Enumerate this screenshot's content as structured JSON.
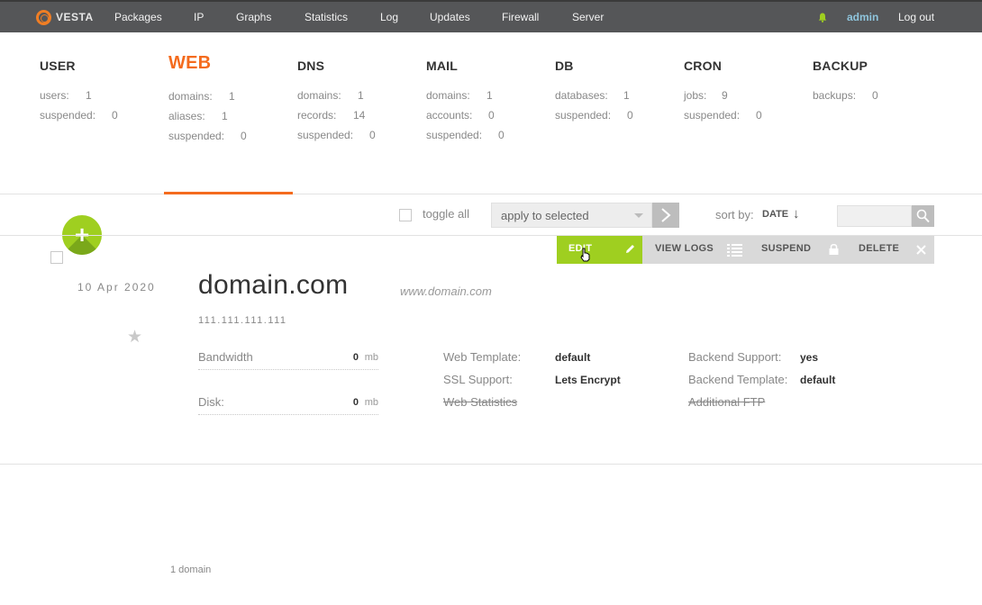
{
  "topbar": {
    "logo_text": "VESTA",
    "nav": [
      "Packages",
      "IP",
      "Graphs",
      "Statistics",
      "Log",
      "Updates",
      "Firewall",
      "Server"
    ],
    "user": "admin",
    "logout": "Log out"
  },
  "stats": [
    {
      "title": "USER",
      "rows": [
        {
          "label": "users:",
          "value": "1"
        },
        {
          "label": "suspended:",
          "value": "0"
        }
      ]
    },
    {
      "title": "WEB",
      "active": true,
      "rows": [
        {
          "label": "domains:",
          "value": "1"
        },
        {
          "label": "aliases:",
          "value": "1"
        },
        {
          "label": "suspended:",
          "value": "0"
        }
      ]
    },
    {
      "title": "DNS",
      "rows": [
        {
          "label": "domains:",
          "value": "1"
        },
        {
          "label": "records:",
          "value": "14"
        },
        {
          "label": "suspended:",
          "value": "0"
        }
      ]
    },
    {
      "title": "MAIL",
      "rows": [
        {
          "label": "domains:",
          "value": "1"
        },
        {
          "label": "accounts:",
          "value": "0"
        },
        {
          "label": "suspended:",
          "value": "0"
        }
      ]
    },
    {
      "title": "DB",
      "rows": [
        {
          "label": "databases:",
          "value": "1"
        },
        {
          "label": "suspended:",
          "value": "0"
        }
      ]
    },
    {
      "title": "CRON",
      "rows": [
        {
          "label": "jobs:",
          "value": "9"
        },
        {
          "label": "suspended:",
          "value": "0"
        }
      ]
    },
    {
      "title": "BACKUP",
      "rows": [
        {
          "label": "backups:",
          "value": "0"
        }
      ]
    }
  ],
  "toolbar": {
    "toggle_all": "toggle all",
    "apply_select": "apply to selected",
    "sort_label": "sort by:",
    "sort_value": "DATE",
    "sort_arrow": "↓",
    "add_symbol": "+"
  },
  "actions": {
    "edit": "EDIT",
    "view_logs": "VIEW LOGS",
    "suspend": "SUSPEND",
    "delete": "DELETE"
  },
  "domain": {
    "date": "10 Apr 2020",
    "name": "domain.com",
    "alias": "www.domain.com",
    "ip": "111.111.111.111",
    "bandwidth_label": "Bandwidth",
    "bandwidth_value": "0",
    "disk_label": "Disk:",
    "disk_value": "0",
    "unit": "mb",
    "web_template_label": "Web Template:",
    "web_template_value": "default",
    "ssl_label": "SSL Support:",
    "ssl_value": "Lets Encrypt",
    "web_stats": "Web Statistics",
    "backend_support_label": "Backend Support:",
    "backend_support_value": "yes",
    "backend_template_label": "Backend Template:",
    "backend_template_value": "default",
    "additional_ftp": "Additional FTP",
    "star": "★"
  },
  "footer": {
    "count": "1 domain"
  },
  "colors": {
    "accent": "#f46b1e",
    "green": "#9fcf20",
    "topbar": "#555658"
  }
}
